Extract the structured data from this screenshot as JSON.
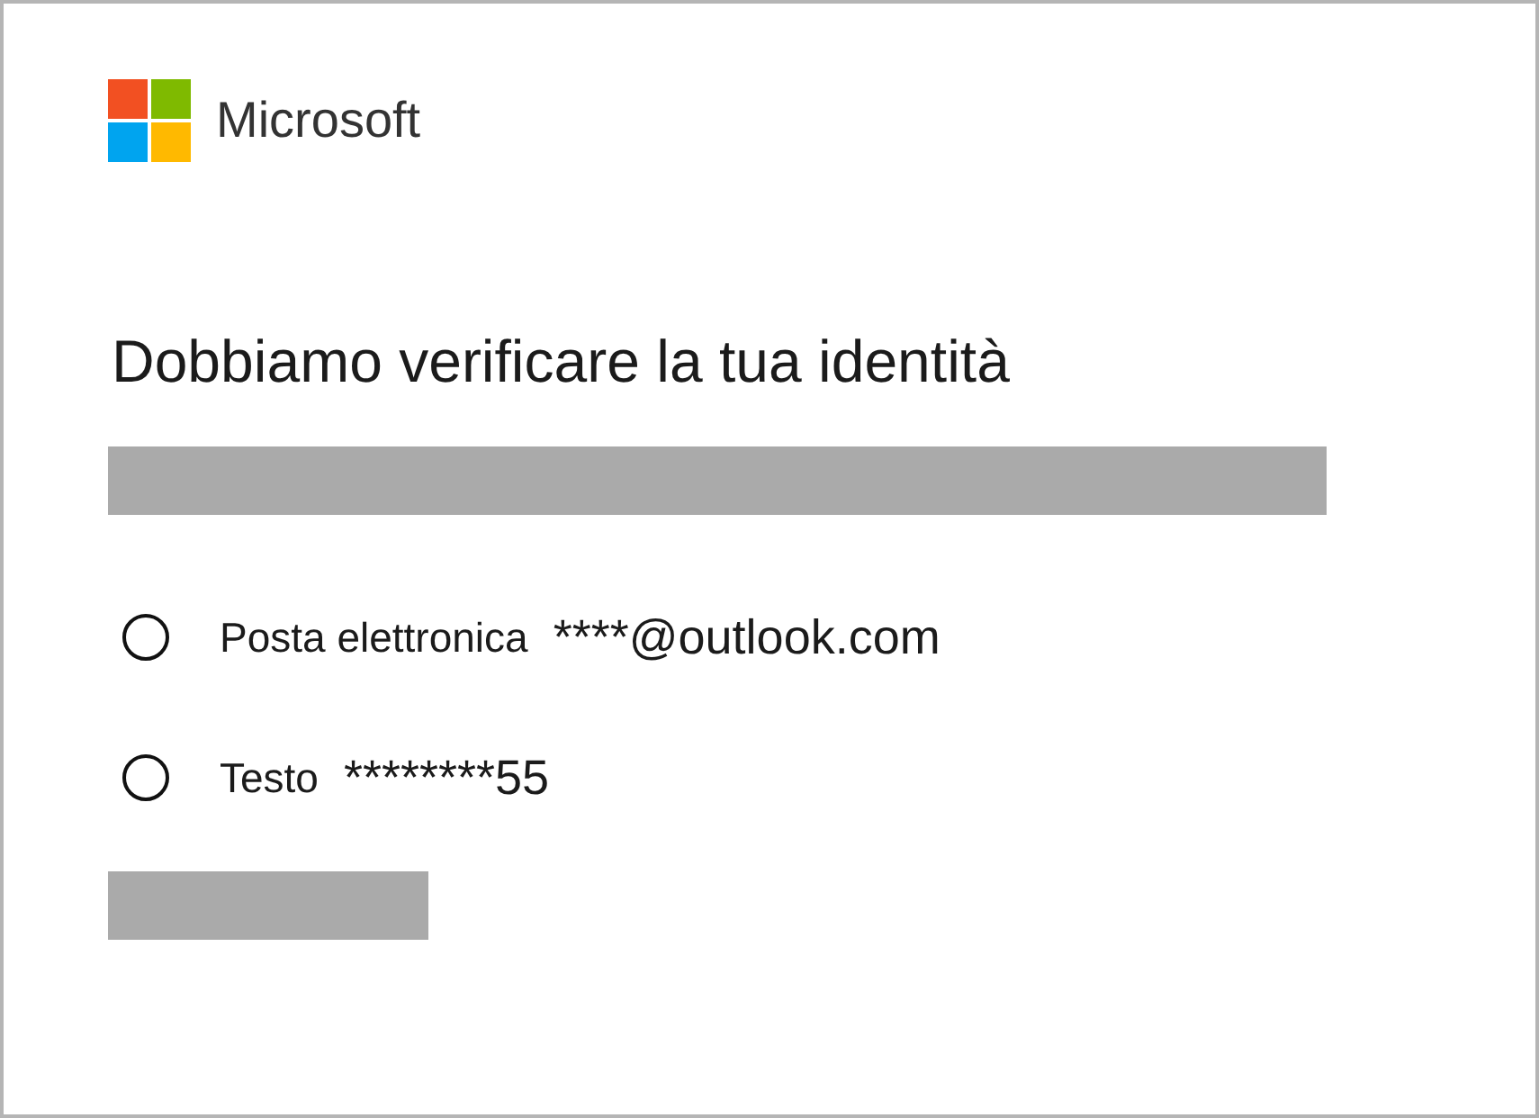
{
  "brand": "Microsoft",
  "title": "Dobbiamo verificare la tua identità",
  "options": [
    {
      "label": "Posta elettronica",
      "value": "****@outlook.com",
      "selected": false
    },
    {
      "label": "Testo",
      "value": "********55",
      "selected": false
    }
  ]
}
